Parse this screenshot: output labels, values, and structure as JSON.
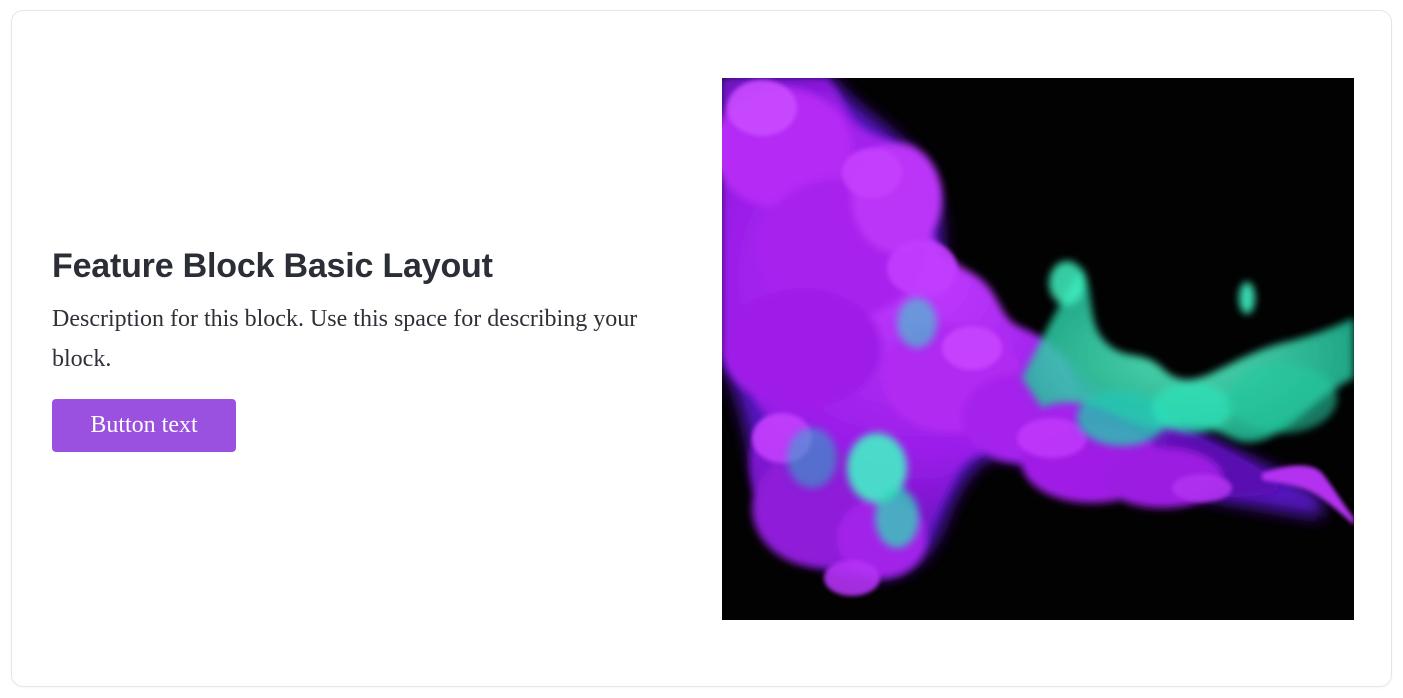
{
  "feature_block": {
    "title": "Feature Block Basic Layout",
    "description": "Description for this block. Use this space for describing your block.",
    "button_label": "Button text"
  },
  "colors": {
    "accent": "#9b51e0",
    "title_text": "#2b2e36",
    "body_text": "#2f3138",
    "image_background": "#020202",
    "smoke_purple": "#a31ef0",
    "smoke_teal": "#2ee8b4"
  },
  "media": {
    "image_subject": "purple-and-teal-ink-smoke-on-black"
  }
}
